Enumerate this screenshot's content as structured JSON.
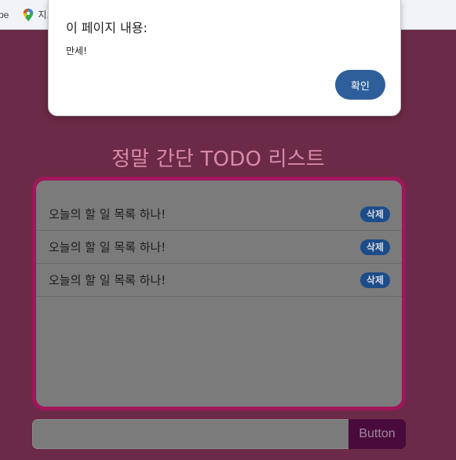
{
  "bookmarks_bar": {
    "items": [
      {
        "label": "be",
        "icon": "cut-off-bookmark"
      },
      {
        "label": "지...",
        "icon": "google-maps-icon"
      }
    ]
  },
  "alert": {
    "title": "이 페이지 내용:",
    "message": "만세!",
    "ok_label": "확인",
    "ok_color": "#2f5f9a"
  },
  "app": {
    "title": "정말 간단 TODO 리스트",
    "todos": [
      {
        "text": "오늘의 할 일 목록 하나!",
        "delete_label": "삭제"
      },
      {
        "text": "오늘의 할 일 목록 하나!",
        "delete_label": "삭제"
      },
      {
        "text": "오늘의 할 일 목록 하나!",
        "delete_label": "삭제"
      }
    ],
    "input": {
      "value": "",
      "placeholder": ""
    },
    "add_button_label": "Button",
    "colors": {
      "page_background": "#6b2a47",
      "frame_border": "#a0165a",
      "add_button": "#4a0b3c",
      "delete_button": "#1d4c8a"
    }
  }
}
